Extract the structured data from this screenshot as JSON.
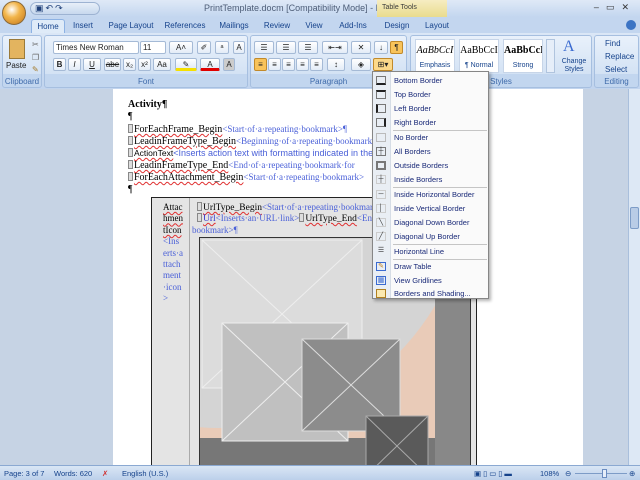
{
  "window": {
    "title": "PrintTemplate.docm [Compatibility Mode] - Microsoft Word",
    "context_tab": "Table Tools",
    "controls": [
      "–",
      "▭",
      "✕"
    ]
  },
  "tabs": [
    "Home",
    "Insert",
    "Page Layout",
    "References",
    "Mailings",
    "Review",
    "View",
    "Add-Ins",
    "Design",
    "Layout"
  ],
  "ribbon": {
    "clipboard": {
      "label": "Clipboard",
      "paste": "Paste"
    },
    "font": {
      "label": "Font",
      "font_name": "Times New Roman",
      "font_size": "11",
      "bold": "B",
      "italic": "I",
      "underline": "U",
      "strike": "abe",
      "sub": "x₂",
      "sup": "x²",
      "case": "Aa",
      "grow": "A˄",
      "shrink": "A˅",
      "color": "A"
    },
    "paragraph": {
      "label": "Paragraph",
      "pilcrow": "¶"
    },
    "styles": {
      "label": "Styles",
      "items": [
        {
          "sample": "AaBbCcI",
          "name": "Emphasis"
        },
        {
          "sample": "AaBbCcI",
          "name": "¶ Normal"
        },
        {
          "sample": "AaBbCcI",
          "name": "Strong"
        }
      ],
      "change": "Change Styles"
    },
    "editing": {
      "label": "Editing",
      "find": "Find",
      "replace": "Replace",
      "select": "Select"
    }
  },
  "document": {
    "heading": "Activity¶",
    "pilcrow": "¶",
    "lines": [
      {
        "field": "ForEachFrame_Begin",
        "hint": "<Start·of·a·repeating·bookmark>¶"
      },
      {
        "field": "LeadinFrameType_Begin",
        "hint": "<Beginning·of·a·repeating·bookmark>"
      },
      {
        "field": "ActionText",
        "hint": "<Inserts action text with formatting indicated in the"
      },
      {
        "field": "LeadinFrameType_End",
        "hint": "<End·of·a·repeating·bookmark·for"
      },
      {
        "field": "ForEachAttachment_Begin",
        "hint": "<Start·of·a·repeating·bookmark>"
      }
    ],
    "table": {
      "left_cell_field": "AttachmentIcon",
      "left_cell_hint": "<Inserts·attachment·icon>",
      "right_line1_field": "UrlType_Begin",
      "right_line1_hint": "<Start·of·a·repeating·bookmark>",
      "url_field": "Url",
      "url_hint": "<Inserts·an·URL·link>",
      "url_end_field": "UrlType_End",
      "url_end_hint": "<End·of·a·repeating·",
      "line3": "bookmark>¶"
    }
  },
  "border_menu": {
    "items": [
      "Bottom Border",
      "Top Border",
      "Left Border",
      "Right Border",
      "No Border",
      "All Borders",
      "Outside Borders",
      "Inside Borders",
      "Inside Horizontal Border",
      "Inside Vertical Border",
      "Diagonal Down Border",
      "Diagonal Up Border",
      "Horizontal Line",
      "Draw Table",
      "View Gridlines",
      "Borders and Shading..."
    ]
  },
  "status": {
    "page": "Page: 3 of 7",
    "words": "Words: 620",
    "language": "English (U.S.)",
    "zoom": "108%",
    "zoom_fraction": 0.55
  }
}
